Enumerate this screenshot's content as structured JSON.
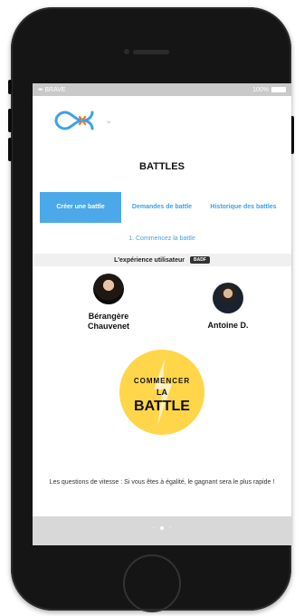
{
  "status": {
    "carrier": "BRAVE",
    "battery": "100%"
  },
  "header": {
    "logo_icon": "infinity-logo",
    "dropdown_icon": "chevron-down-icon"
  },
  "page": {
    "title": "BATTLES"
  },
  "tabs": [
    {
      "label": "Créer une battle",
      "active": true
    },
    {
      "label": "Demandes de battle",
      "active": false
    },
    {
      "label": "Historique des battles",
      "active": false
    }
  ],
  "step": {
    "label": "1. Commencez la battle"
  },
  "experience": {
    "label": "L'expérience utilisateur",
    "badge": "BADF"
  },
  "players": [
    {
      "name": "Bérangère Chauvenet",
      "avatar": "avatar-woman"
    },
    {
      "name": "Antoine D.",
      "avatar": "avatar-man"
    }
  ],
  "start": {
    "line1": "COMMENCER",
    "line2": "LA",
    "line3": "BATTLE",
    "color": "#FFD64A"
  },
  "info": {
    "text": "Les questions de vitesse : Si vous êtes à égalité, le gagnant sera le plus rapide !"
  },
  "pager": {
    "left": "◦",
    "right": "◦"
  },
  "colors": {
    "accent": "#4BA9EA",
    "accent_text": "#3EA1E6"
  }
}
